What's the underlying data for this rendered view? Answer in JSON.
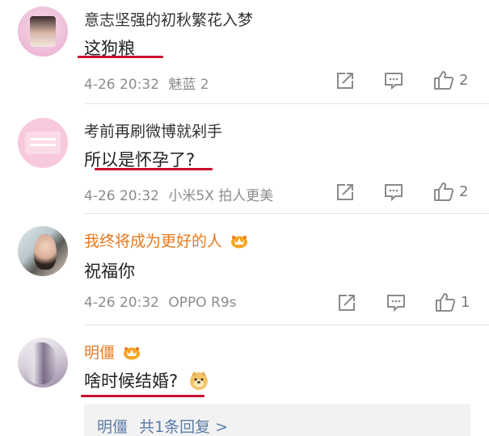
{
  "comments": [
    {
      "username": "意志坚强的初秋繁花入梦",
      "text": "这狗粮",
      "time": "4-26 20:32",
      "device": "魅蓝 2",
      "likes": "2",
      "vip": false
    },
    {
      "username": "考前再刷微博就剁手",
      "text": "所以是怀孕了?",
      "time": "4-26 20:32",
      "device": "小米5X 拍人更美",
      "likes": "2",
      "vip": false
    },
    {
      "username": "我终将成为更好的人",
      "text": "祝福你",
      "time": "4-26 20:32",
      "device": "OPPO R9s",
      "likes": "1",
      "vip": true
    },
    {
      "username": "明僵",
      "text": "啥时候结婚?",
      "vip": true
    }
  ],
  "reply_preview": {
    "author": "明僵",
    "summary": "共1条回复 >"
  },
  "colors": {
    "vip_name": "#e9781c",
    "underline": "#c8102e",
    "reply_link": "#5a7ba6",
    "meta": "#8c8c8c"
  },
  "icons": [
    "share-icon",
    "comment-icon",
    "like-icon",
    "vip-crown-icon",
    "doge-emoji-icon"
  ]
}
